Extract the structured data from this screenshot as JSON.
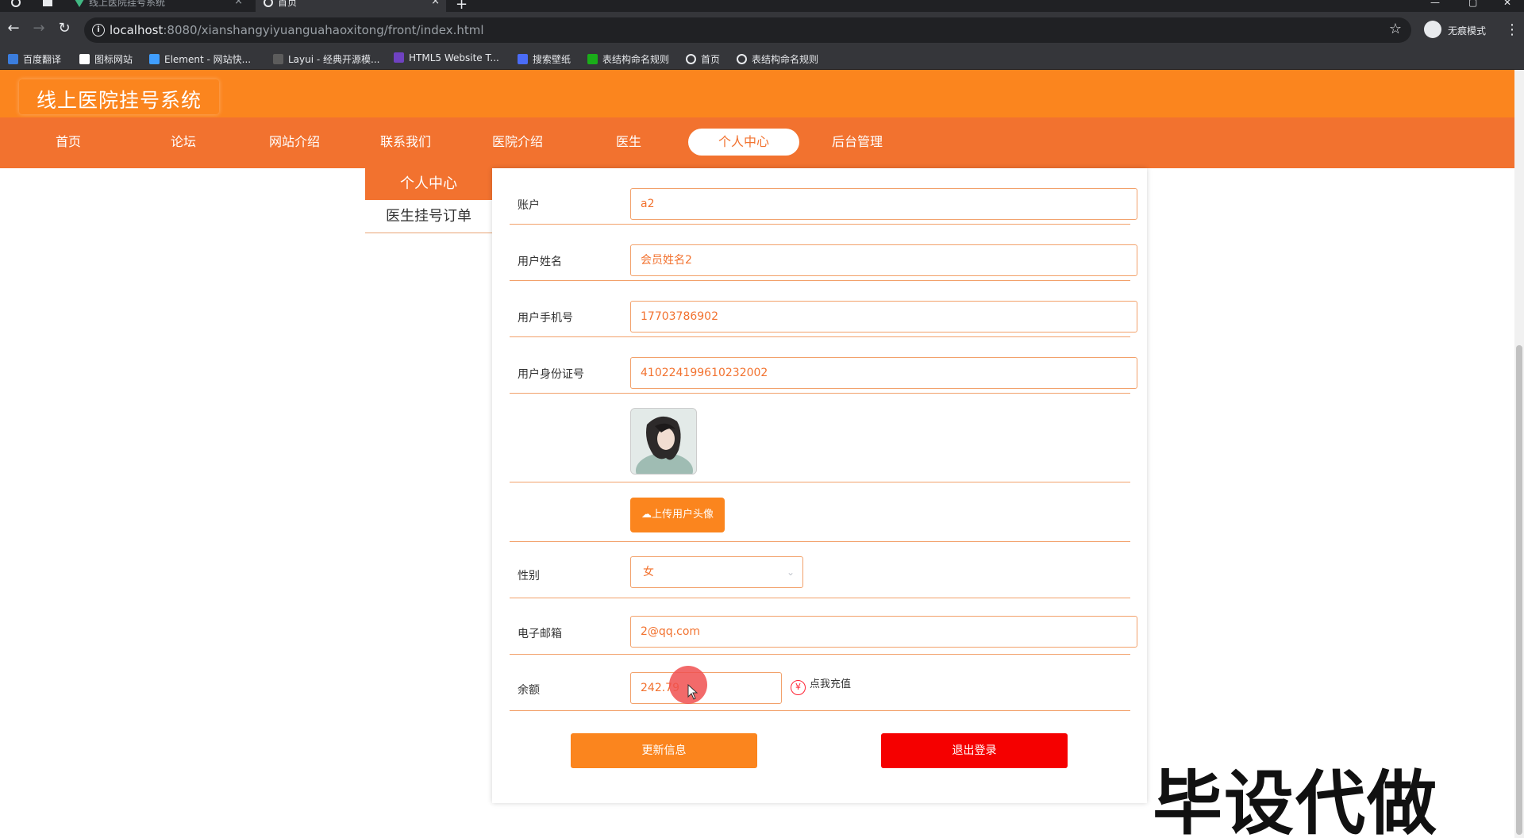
{
  "browser": {
    "tabs": [
      {
        "title": "",
        "active": false
      },
      {
        "title": "",
        "active": false
      },
      {
        "title": "线上医院挂号系统",
        "active": false
      },
      {
        "title": "首页",
        "active": true
      }
    ],
    "close_glyph": "×",
    "new_tab_glyph": "+",
    "url_host": "localhost",
    "url_rest": ":8080/xianshangyiyuanguahaoxitong/front/index.html",
    "incognito_label": "无痕模式",
    "bookmarks": [
      {
        "label": "百度翻译",
        "color": "#3b7ddd"
      },
      {
        "label": "图标网站",
        "color": "#ffffff"
      },
      {
        "label": "Element - 网站快...",
        "color": "#409eff"
      },
      {
        "label": "Layui - 经典开源模...",
        "color": "#e8eaed"
      },
      {
        "label": "HTML5 Website T...",
        "color": "#6f42c1"
      },
      {
        "label": "搜索壁纸",
        "color": "#4a6cf7"
      },
      {
        "label": "表结构命名规则",
        "color": "#1aad19"
      },
      {
        "label": "首页",
        "color": "#e8eaed"
      },
      {
        "label": "表结构命名规则",
        "color": "#e8eaed"
      }
    ]
  },
  "site": {
    "title": "线上医院挂号系统",
    "nav": [
      "首页",
      "论坛",
      "网站介绍",
      "联系我们",
      "医院介绍",
      "医生",
      "个人中心",
      "后台管理"
    ],
    "nav_active_index": 6,
    "sidebar": [
      "个人中心",
      "医生挂号订单"
    ],
    "colors": {
      "primary": "#fb851e",
      "nav": "#f2722f",
      "danger": "#f50000"
    }
  },
  "form": {
    "account_label": "账户",
    "account_value": "a2",
    "name_label": "用户姓名",
    "name_value": "会员姓名2",
    "phone_label": "用户手机号",
    "phone_value": "17703786902",
    "idcard_label": "用户身份证号",
    "idcard_value": "410224199610232002",
    "upload_label": "上传用户头像",
    "gender_label": "性别",
    "gender_value": "女",
    "email_label": "电子邮箱",
    "email_value": "2@qq.com",
    "balance_label": "余额",
    "balance_value": "242.79",
    "recharge_label": "点我充值",
    "update_button": "更新信息",
    "logout_button": "退出登录"
  },
  "watermark": "毕设代做"
}
